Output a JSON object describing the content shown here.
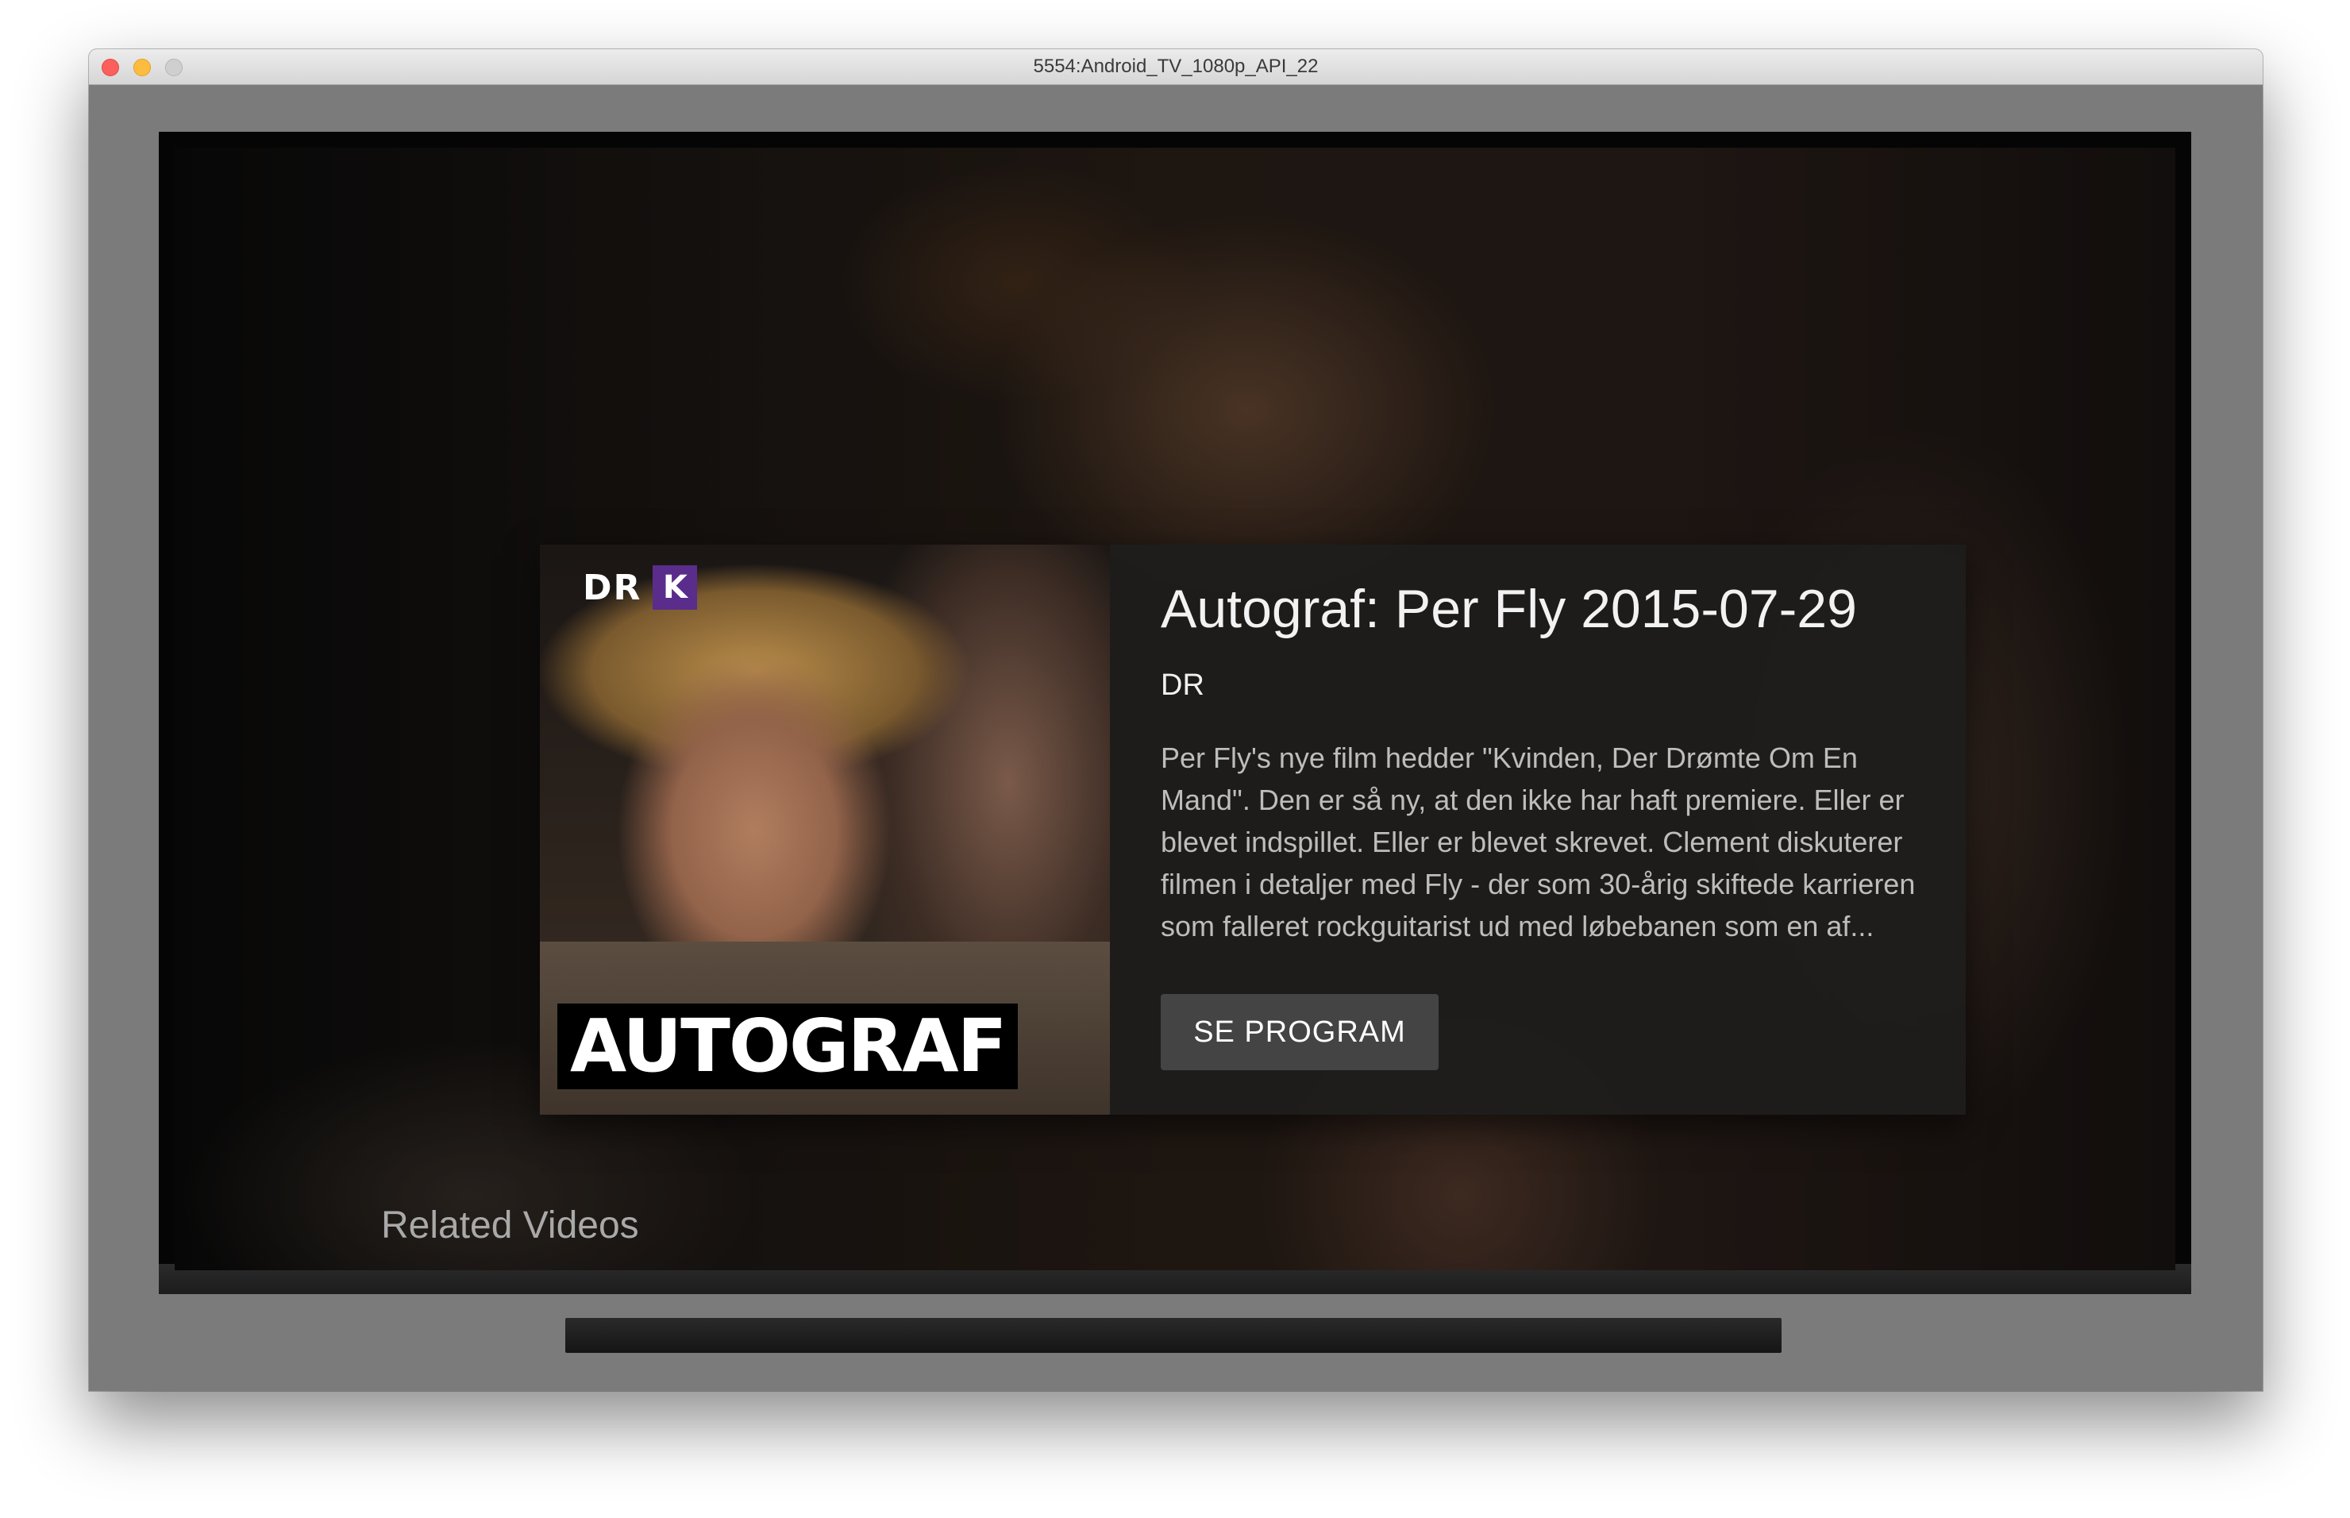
{
  "window": {
    "title": "5554:Android_TV_1080p_API_22"
  },
  "details": {
    "poster": {
      "channel_logo": "DR",
      "channel_badge": "K",
      "title_text": "AUTOGRAF"
    },
    "title": "Autograf: Per Fly 2015-07-29",
    "subtitle": "DR",
    "description": "Per Fly's nye film hedder \"Kvinden, Der Drømte Om En Mand\". Den er så ny, at den ikke har haft premiere. Eller er blevet indspillet. Eller er blevet skrevet. Clement diskuterer filmen i detaljer med Fly - der som 30-årig skiftede karrieren som falleret rockguitarist ud med løbebanen som en af...",
    "action_label": "SE PROGRAM"
  },
  "related": {
    "header": "Related Videos"
  },
  "colors": {
    "badge_purple": "#5a2d8c",
    "info_panel": "#1e1d1c",
    "button": "#444444",
    "close": "#fc605c",
    "minimize": "#fdbc40",
    "zoom": "#cfcfcf"
  },
  "icons": [
    "close-icon",
    "minimize-icon",
    "zoom-icon"
  ]
}
